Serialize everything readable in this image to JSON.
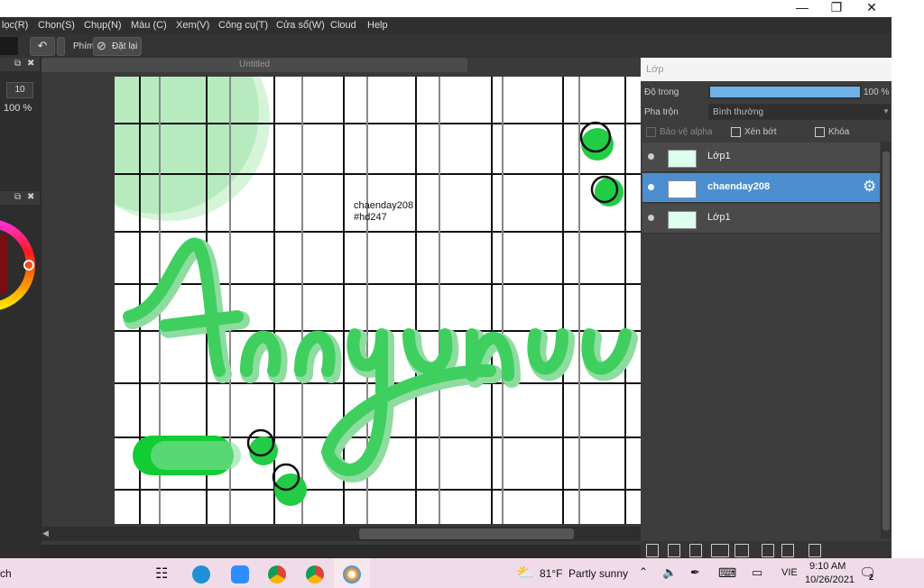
{
  "menu": [
    "lọc(R)",
    "Chọn(S)",
    "Chụp(N)",
    "Màu (C)",
    "Xem(V)",
    "Công cụ(T)",
    "Cửa sổ(W)",
    "Cloud",
    "Help"
  ],
  "toolbar": {
    "key_label": "Phím",
    "reset_label": "Đặt lại"
  },
  "left_panel": {
    "brush_size": "10",
    "opacity": "100 %"
  },
  "document": {
    "title": "Untitled",
    "canvas_note_line1": "chaenday208",
    "canvas_note_line2": "#hd247"
  },
  "layer_panel": {
    "title": "Lớp",
    "opacity_label": "Độ trong",
    "opacity_value": "100 %",
    "opacity_fraction": 1.0,
    "blend_label": "Pha trộn",
    "blend_value": "Bình thường",
    "protect_alpha": "Bảo vệ alpha",
    "clip": "Xén bớt",
    "lock": "Khóa",
    "layers": [
      {
        "name": "Lớp1",
        "selected": false
      },
      {
        "name": "chaenday208",
        "selected": true
      },
      {
        "name": "Lớp1",
        "selected": false
      }
    ]
  },
  "taskbar": {
    "search_fragment": "ch",
    "weather_temp": "81°F",
    "weather_text": "Partly sunny",
    "language": "VIE",
    "time": "9:10 AM",
    "date": "10/26/2021",
    "notification_count": "2"
  },
  "colors": {
    "accent_green": "#2ecc40",
    "selection_blue": "#4b8fd1"
  }
}
